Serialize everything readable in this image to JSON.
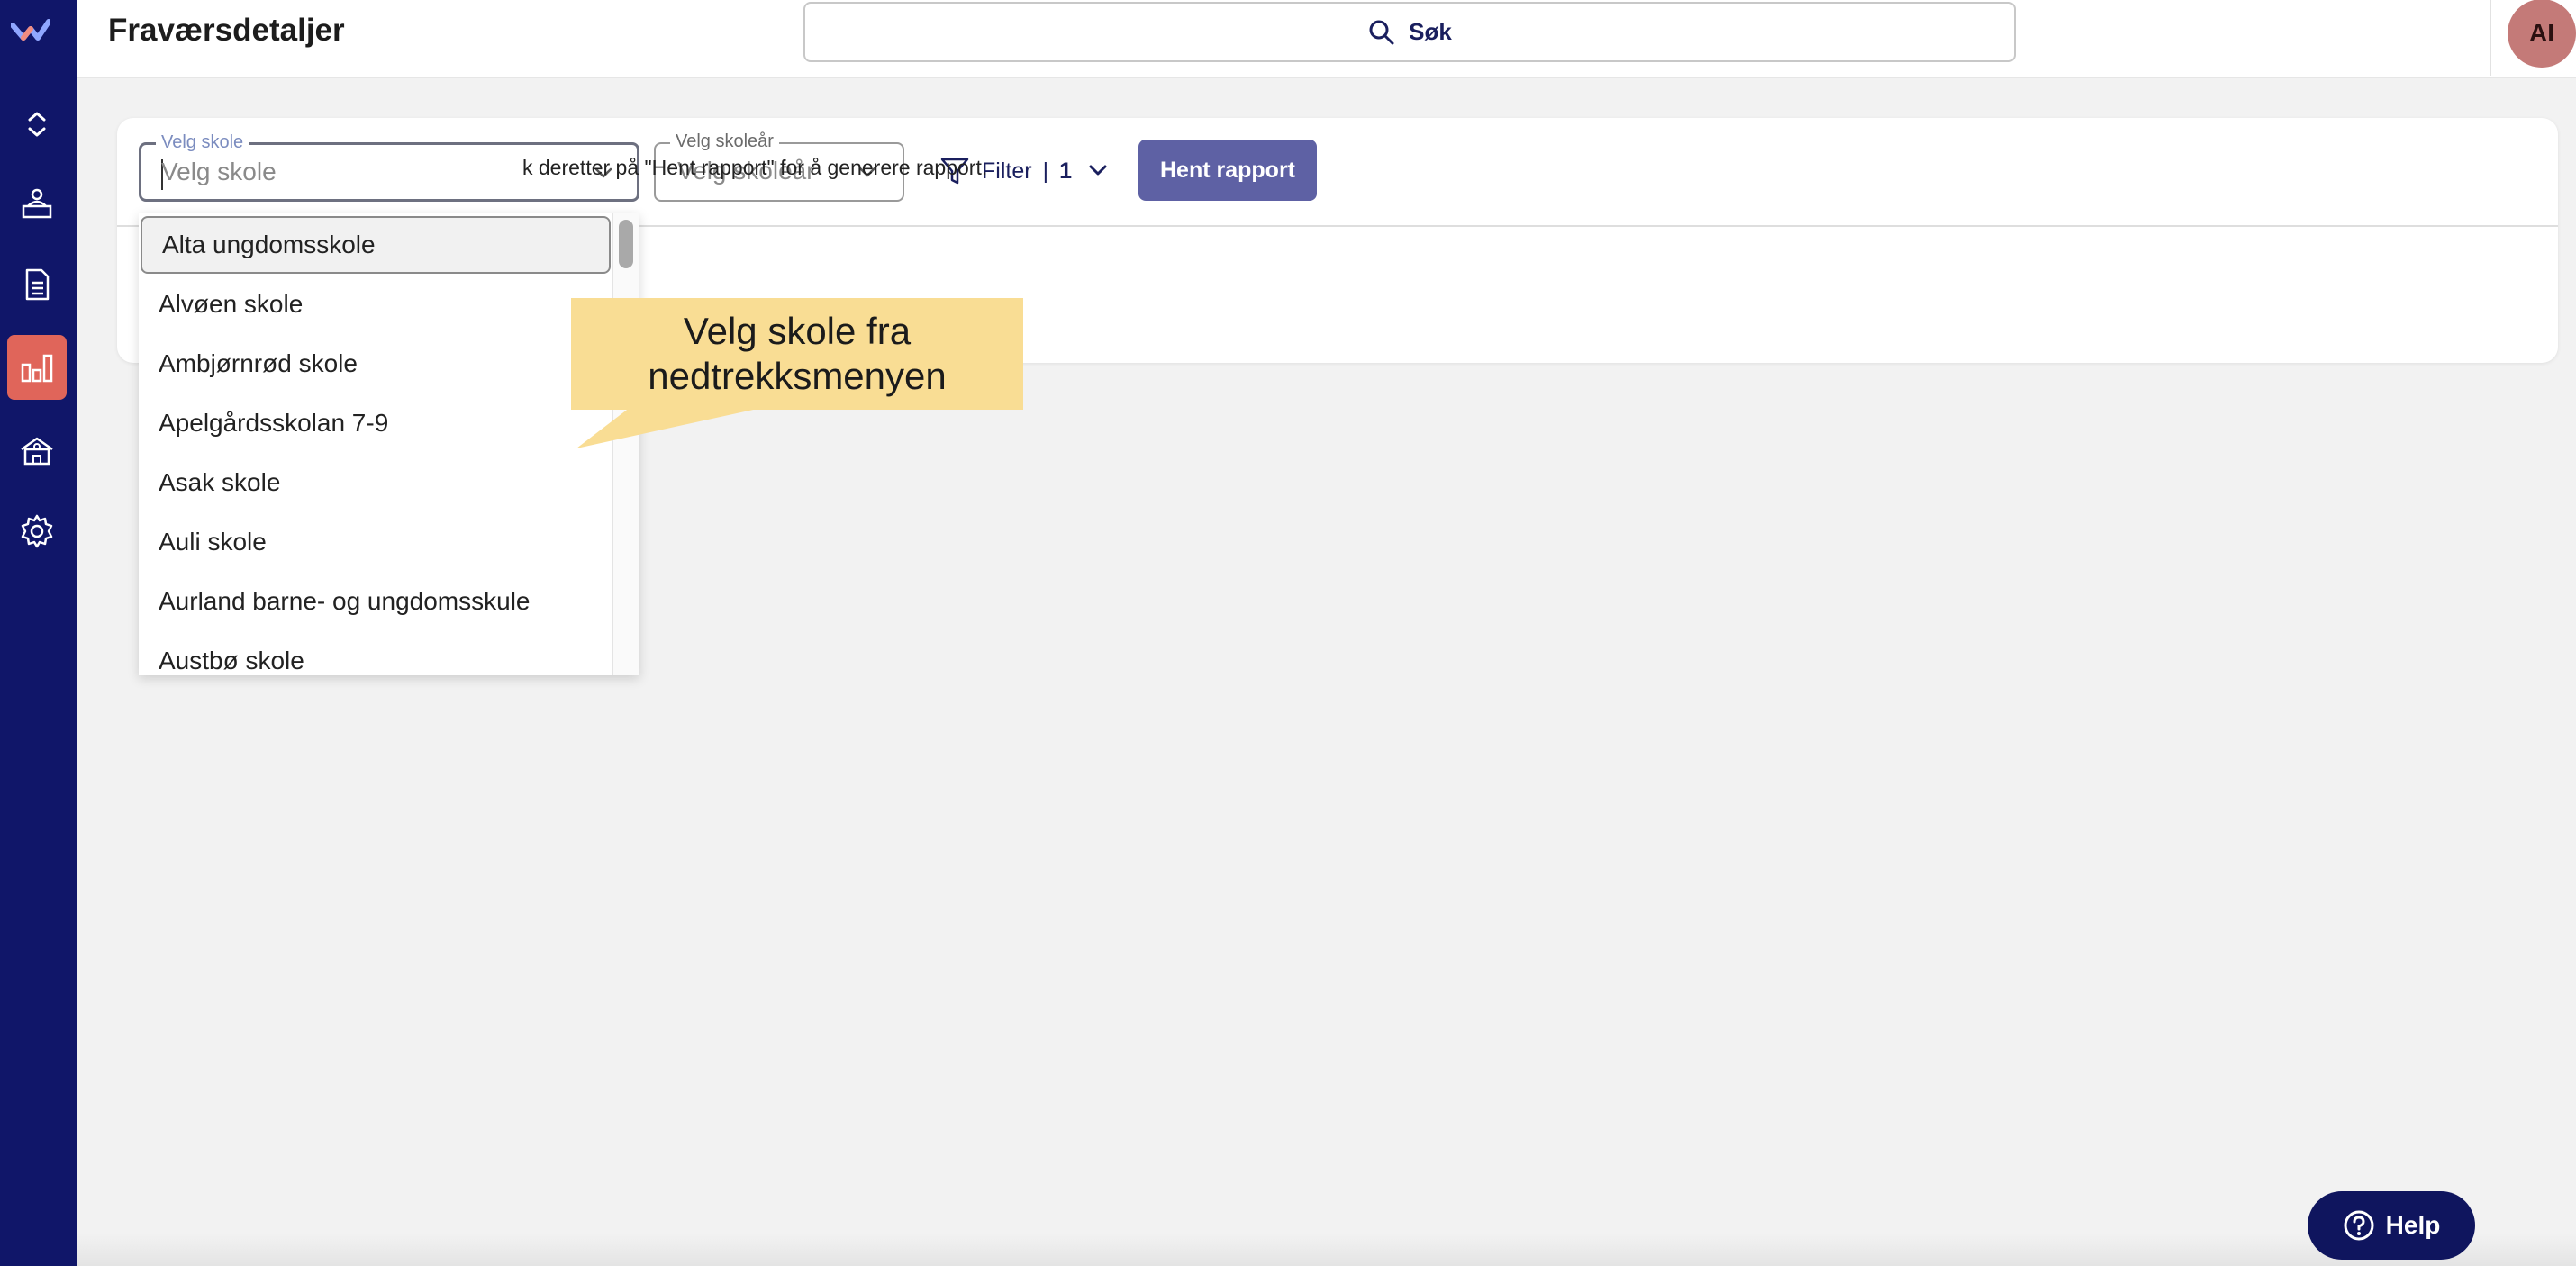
{
  "app": {
    "page_title": "Fraværsdetaljer",
    "search_label": "Søk",
    "avatar_initials": "AI"
  },
  "sidebar": {
    "items": [
      {
        "icon": "expand-collapse-icon"
      },
      {
        "icon": "user-desk-icon"
      },
      {
        "icon": "document-icon"
      },
      {
        "icon": "bar-chart-icon",
        "active": true
      },
      {
        "icon": "school-building-icon"
      },
      {
        "icon": "gear-icon"
      }
    ],
    "active_color": "#e0655a",
    "background": "#101669"
  },
  "filters": {
    "school_legend": "Velg skole",
    "school_placeholder": "Velg skole",
    "year_legend": "Velg skoleår",
    "year_placeholder": "Velg skoleår",
    "filter_label": "Filter",
    "filter_separator": "|",
    "filter_count": "1",
    "report_button": "Hent rapport"
  },
  "info_text": "k deretter på \"Hent rapport\" for å generere rapport.",
  "dropdown": {
    "options": [
      "Alta ungdomsskole",
      "Alvøen skole",
      "Ambjørnrød skole",
      "Apelgårdsskolan 7-9",
      "Asak skole",
      "Auli skole",
      "Aurland barne- og ungdomsskule",
      "Austbø skole"
    ],
    "selected_index": 0
  },
  "callout": {
    "line1": "Velg skole fra",
    "line2": "nedtrekksmenyen"
  },
  "help": {
    "label": "Help"
  }
}
